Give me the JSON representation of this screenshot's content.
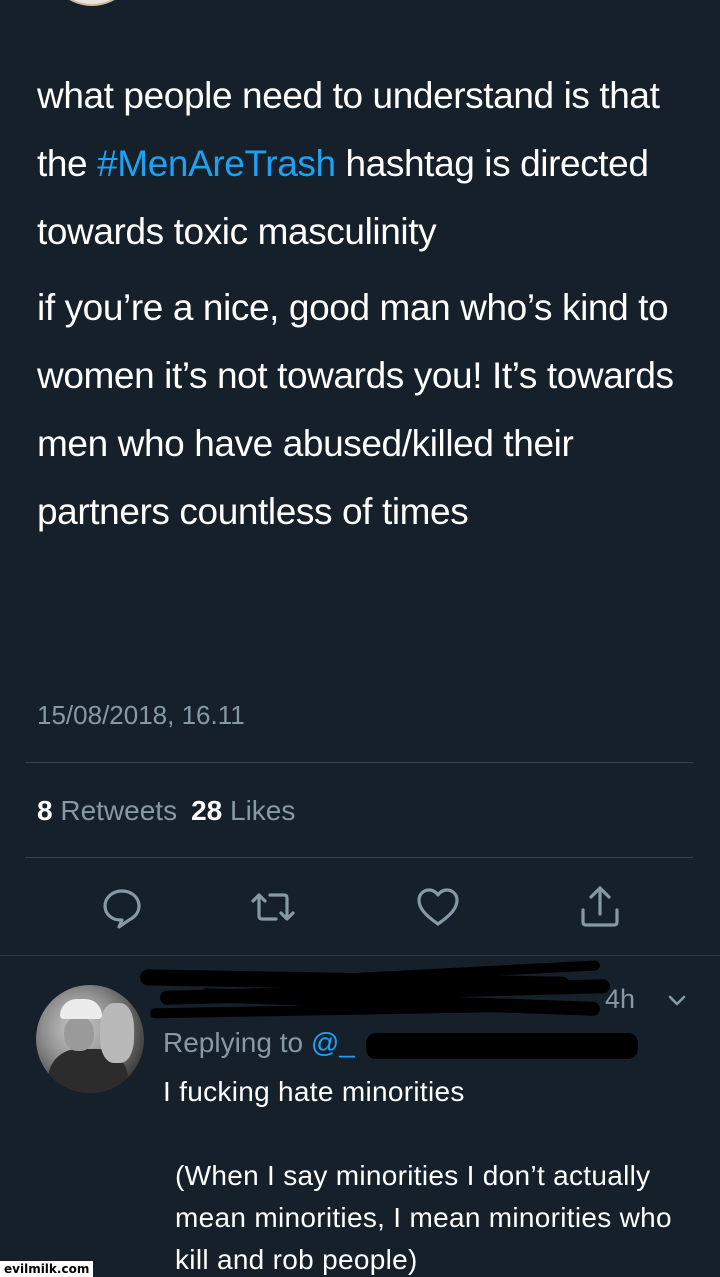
{
  "tweet": {
    "paragraph1_before": "what people need to understand is that the ",
    "hashtag": "#MenAreTrash",
    "paragraph1_after": " hashtag is directed towards toxic masculinity",
    "paragraph2": "if you’re a nice, good man who’s kind to women it’s not towards you! It’s towards men who have abused/killed their partners countless of times",
    "timestamp": "15/08/2018, 16.11",
    "retweets_count": "8",
    "retweets_label": "Retweets",
    "likes_count": "28",
    "likes_label": "Likes"
  },
  "actions": [
    "reply-icon",
    "retweet-icon",
    "heart-icon",
    "share-icon"
  ],
  "reply": {
    "time": "4h",
    "replying_label": "Replying to",
    "handle": "@_",
    "line1": "I fucking hate minorities",
    "line2": "(When I say minorities I don’t actually mean minorities, I mean minorities who kill and rob people)"
  },
  "colors": {
    "background": "#15202b",
    "accent": "#1da1f2",
    "muted": "#8899a6",
    "divider": "#38444d"
  },
  "watermark": "evilmilk.com"
}
